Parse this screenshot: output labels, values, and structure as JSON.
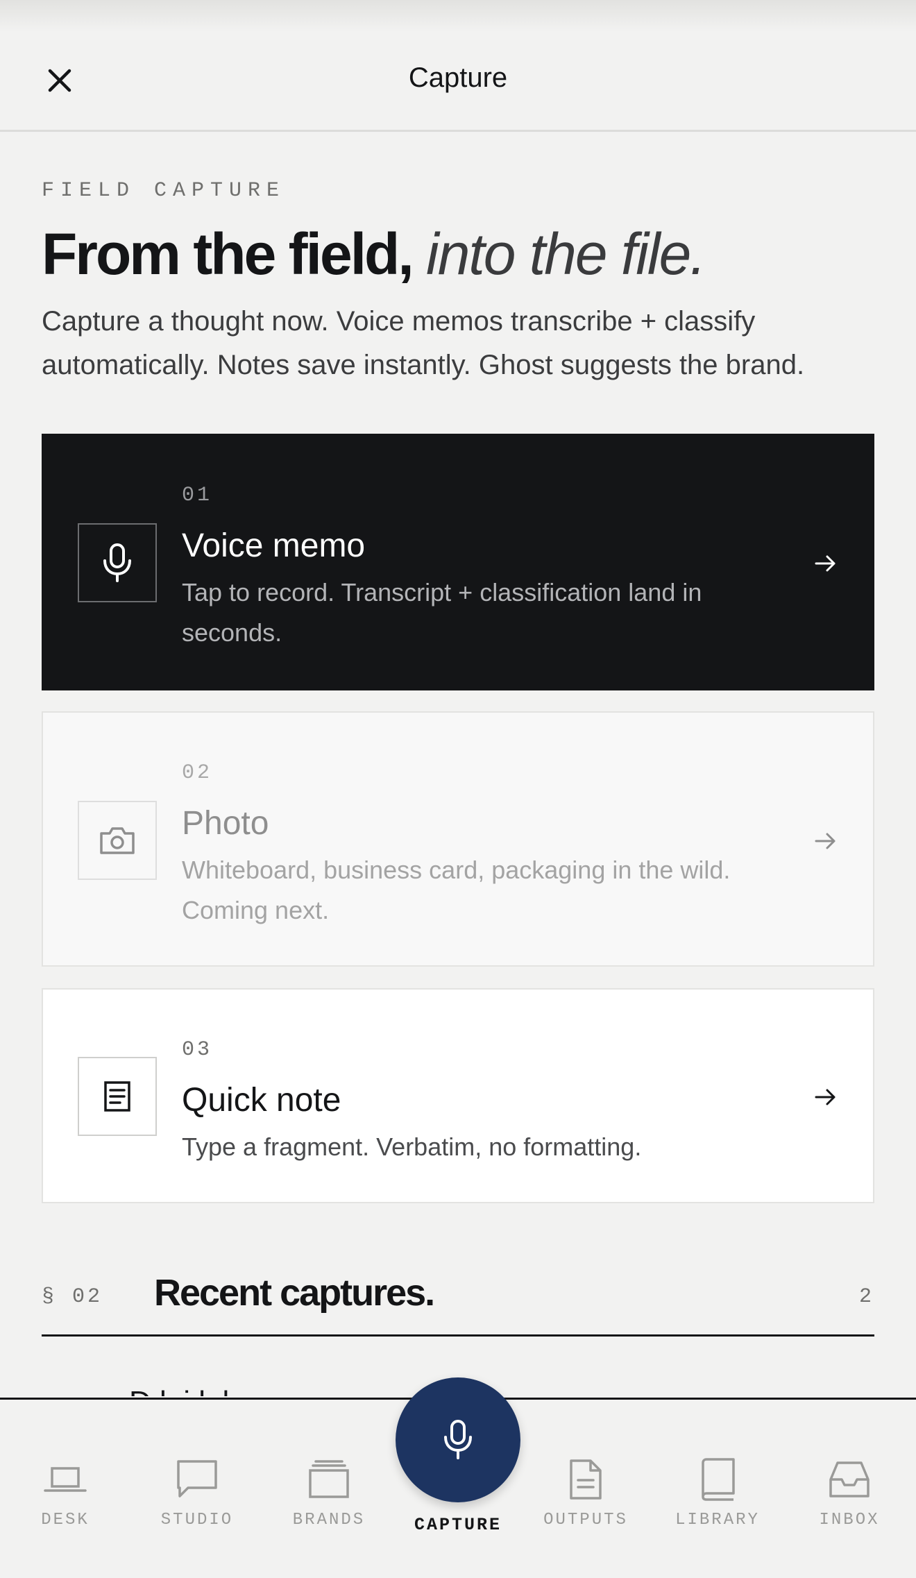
{
  "header": {
    "title": "Capture"
  },
  "intro": {
    "eyebrow": "FIELD CAPTURE",
    "headline_main": "From the field,",
    "headline_italic": "into the file.",
    "lede": "Capture a thought now. Voice memos transcribe + classify automatically. Notes save instantly. Ghost suggests the brand."
  },
  "options": [
    {
      "num": "01",
      "title": "Voice memo",
      "desc": "Tap to record. Transcript + classification land in seconds.",
      "icon": "microphone-icon",
      "state": "active"
    },
    {
      "num": "02",
      "title": "Photo",
      "desc": "Whiteboard, business card, packaging in the wild. Coming next.",
      "icon": "camera-icon",
      "state": "disabled"
    },
    {
      "num": "03",
      "title": "Quick note",
      "desc": "Type a fragment. Verbatim, no formatting.",
      "icon": "note-icon",
      "state": "enabled"
    }
  ],
  "recent": {
    "section_num": "§ 02",
    "title": "Recent captures.",
    "count": "2",
    "peek_text": "D         k          i                                    k   l"
  },
  "tabbar": {
    "tabs": [
      {
        "label": "DESK",
        "icon": "laptop-icon"
      },
      {
        "label": "STUDIO",
        "icon": "chat-bubble-icon"
      },
      {
        "label": "BRANDS",
        "icon": "stack-icon"
      },
      {
        "label": "CAPTURE",
        "icon": "microphone-icon",
        "active": true
      },
      {
        "label": "OUTPUTS",
        "icon": "document-icon"
      },
      {
        "label": "LIBRARY",
        "icon": "book-icon"
      },
      {
        "label": "INBOX",
        "icon": "inbox-icon"
      }
    ]
  },
  "colors": {
    "accent": "#1d3461",
    "ink": "#141517",
    "background": "#f2f2f1"
  }
}
